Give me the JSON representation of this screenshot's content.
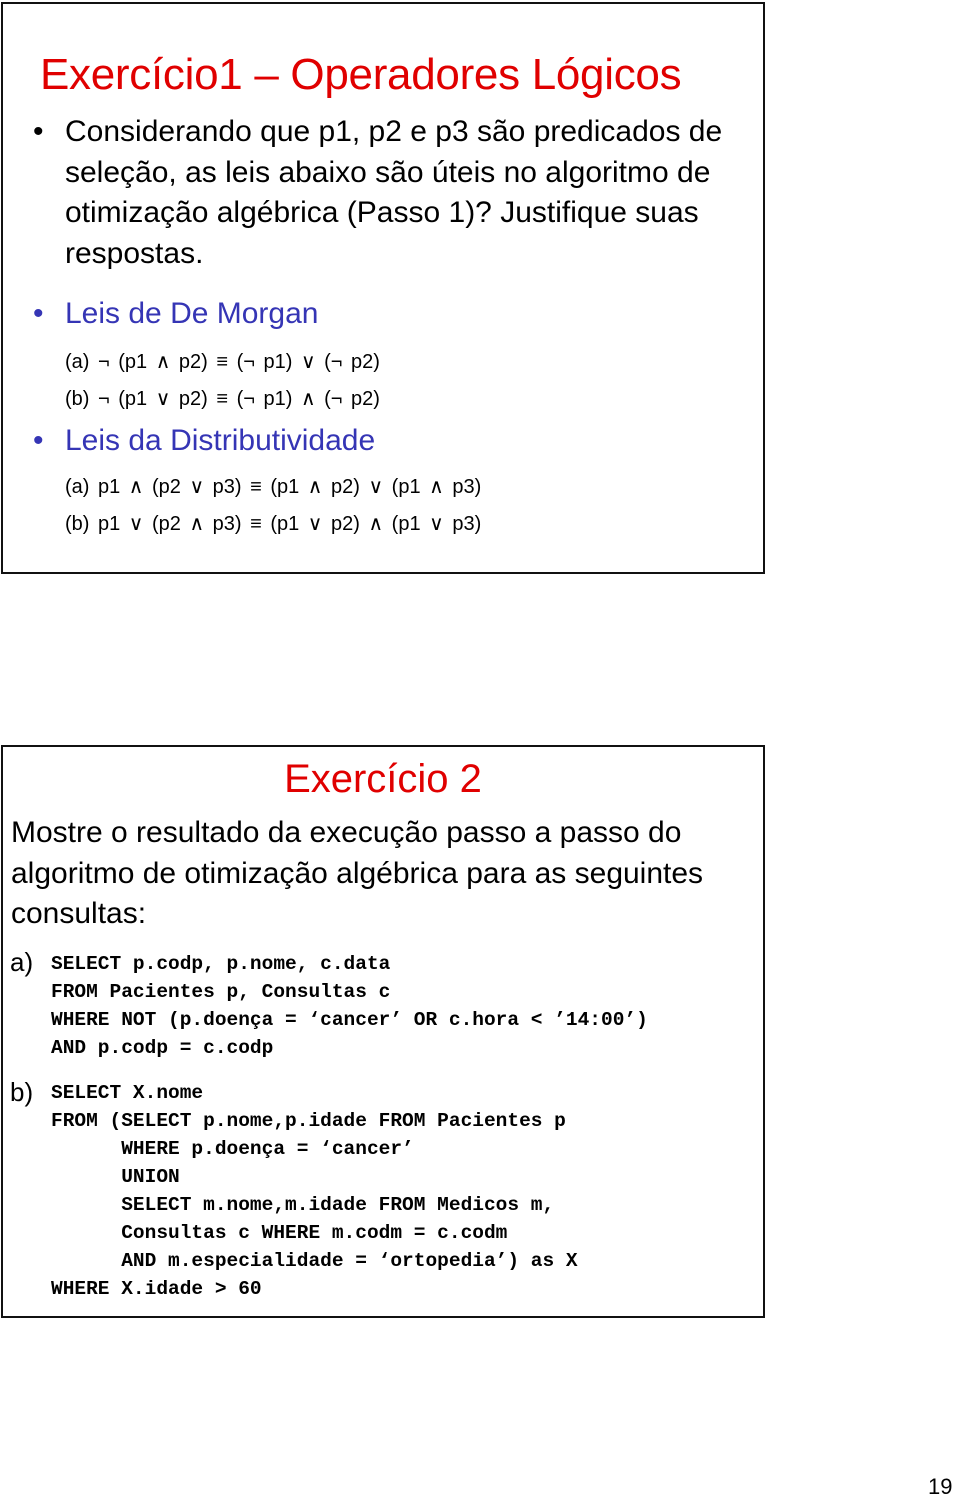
{
  "exercise1": {
    "title": "Exercício1 – Operadores Lógicos",
    "bullet_symbol": "•",
    "question": "Considerando que p1, p2 e p3 são predicados de seleção, as leis abaixo são úteis no algoritmo de otimização algébrica (Passo 1)? Justifique suas respostas.",
    "sections": [
      {
        "heading": "Leis de De Morgan",
        "laws": [
          "(a) ¬ (p1 ∧ p2) ≡ (¬ p1) ∨ (¬ p2)",
          "(b) ¬ (p1 ∨ p2) ≡ (¬ p1) ∧ (¬ p2)"
        ]
      },
      {
        "heading": "Leis da Distributividade",
        "laws": [
          "(a) p1 ∧ (p2 ∨ p3) ≡ (p1 ∧ p2) ∨ (p1 ∧ p3)",
          "(b) p1 ∨ (p2 ∧ p3) ≡ (p1 ∨ p2) ∧ (p1 ∨ p3)"
        ]
      }
    ]
  },
  "exercise2": {
    "title": "Exercício 2",
    "prompt": "Mostre o resultado da execução passo a passo do algoritmo de otimização algébrica para as seguintes consultas:",
    "queries": [
      {
        "label": "a)",
        "sql": "SELECT p.codp, p.nome, c.data\nFROM Pacientes p, Consultas c\nWHERE NOT (p.doença = ‘cancer’ OR c.hora < ’14:00’)\nAND p.codp = c.codp"
      },
      {
        "label": "b)",
        "sql": "SELECT X.nome\nFROM (SELECT p.nome,p.idade FROM Pacientes p\n      WHERE p.doença = ‘cancer’\n      UNION\n      SELECT m.nome,m.idade FROM Medicos m,\n      Consultas c WHERE m.codm = c.codm\n      AND m.especialidade = ‘ortopedia’) as X\nWHERE X.idade > 60"
      }
    ]
  },
  "page_number": "19",
  "colors": {
    "title": "#e00000",
    "subheading": "#3535b5",
    "text": "#000000",
    "border": "#111111"
  }
}
